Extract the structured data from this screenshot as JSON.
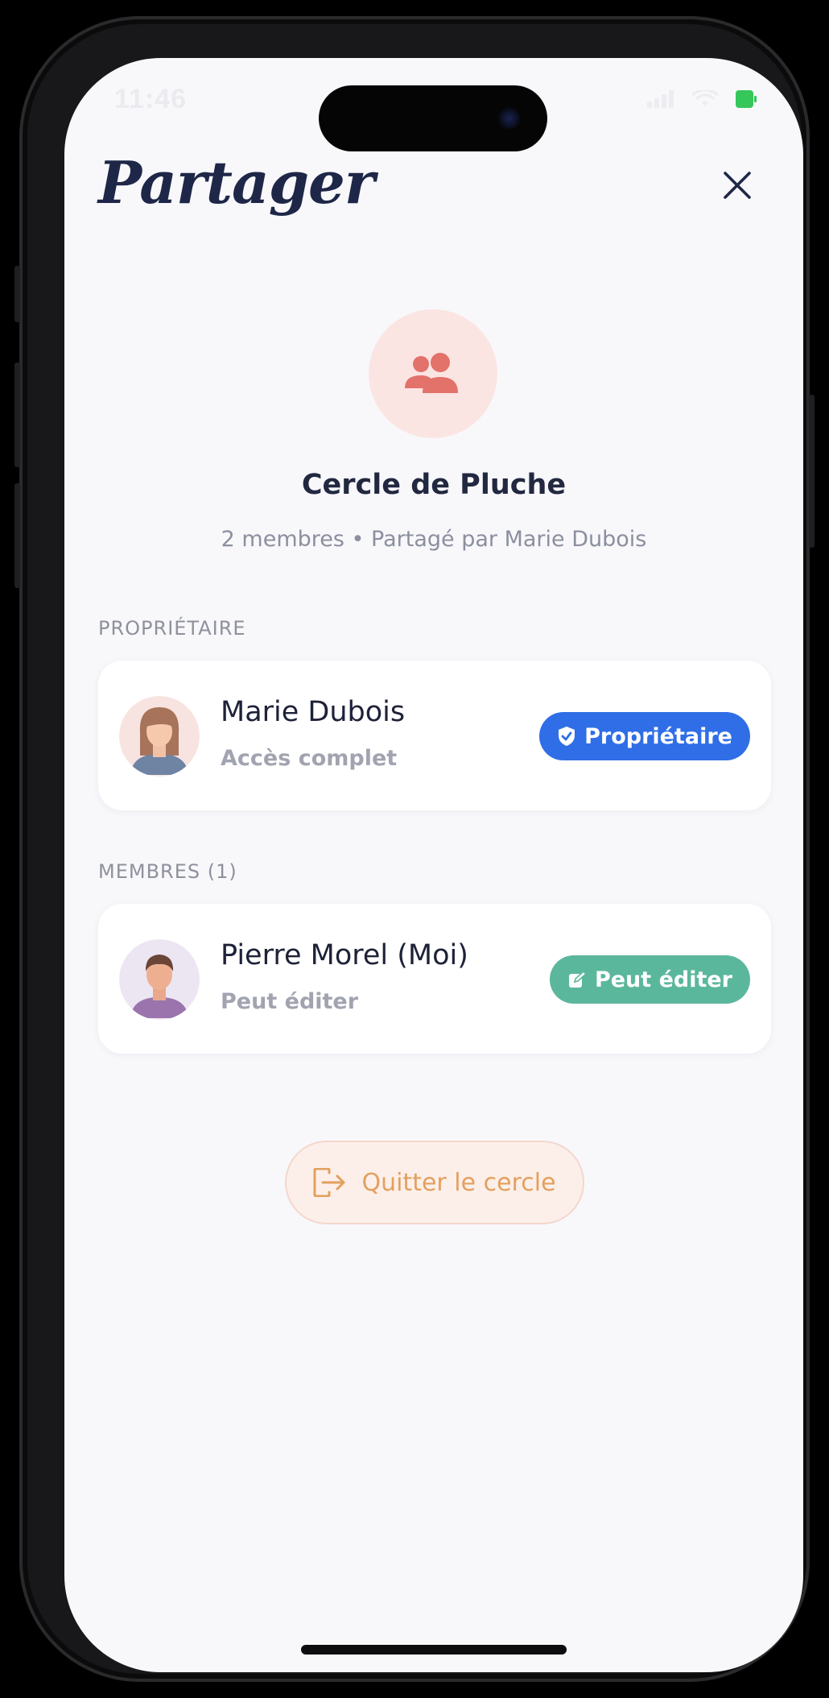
{
  "status_bar": {
    "time": "11:46"
  },
  "header": {
    "title": "Partager",
    "close_icon": "close-icon"
  },
  "group": {
    "icon": "users-icon",
    "icon_color": "#e2726a",
    "name": "Cercle de Pluche",
    "meta": "2 membres • Partagé par Marie Dubois"
  },
  "owner_section": {
    "label": "PROPRIÉTAIRE",
    "member": {
      "name": "Marie Dubois",
      "subtitle": "Accès complet",
      "badge_label": "Propriétaire",
      "badge_icon": "shield-check-icon",
      "badge_color": "#2f6ee6"
    }
  },
  "members_section": {
    "label": "MEMBRES (1)",
    "member": {
      "name": "Pierre Morel (Moi)",
      "subtitle": "Peut éditer",
      "badge_label": "Peut éditer",
      "badge_icon": "edit-icon",
      "badge_color": "#5bb79b"
    }
  },
  "actions": {
    "leave_label": "Quitter le cercle",
    "leave_icon": "logout-icon"
  }
}
